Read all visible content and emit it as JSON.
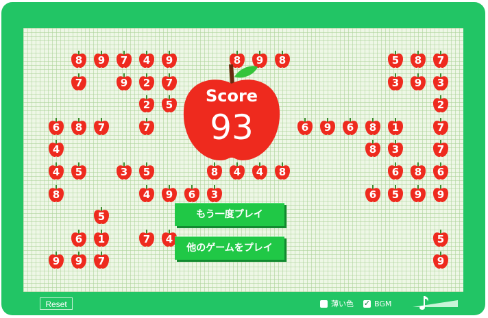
{
  "score": {
    "label": "Score",
    "value": "93"
  },
  "buttons": {
    "play_again": "もう一度プレイ",
    "other_games": "他のゲームをプレイ"
  },
  "controls": {
    "reset": "Reset",
    "pale_color": {
      "label": "薄い色",
      "checked": false
    },
    "bgm": {
      "label": "BGM",
      "checked": true
    },
    "volume_icon": "music-note-icon"
  },
  "colors": {
    "frame": "#22c565",
    "apple": "#ee2a1e",
    "leaf": "#34c43a",
    "button": "#20c846"
  },
  "apples": [
    {
      "n": "8",
      "c": 0,
      "r": 0
    },
    {
      "n": "9",
      "c": 1,
      "r": 0
    },
    {
      "n": "7",
      "c": 2,
      "r": 0
    },
    {
      "n": "4",
      "c": 3,
      "r": 0
    },
    {
      "n": "9",
      "c": 4,
      "r": 0
    },
    {
      "n": "8",
      "c": 7,
      "r": 0
    },
    {
      "n": "9",
      "c": 8,
      "r": 0
    },
    {
      "n": "8",
      "c": 9,
      "r": 0
    },
    {
      "n": "5",
      "c": 14,
      "r": 0
    },
    {
      "n": "8",
      "c": 15,
      "r": 0
    },
    {
      "n": "7",
      "c": 16,
      "r": 0
    },
    {
      "n": "7",
      "c": 0,
      "r": 1
    },
    {
      "n": "9",
      "c": 2,
      "r": 1
    },
    {
      "n": "2",
      "c": 3,
      "r": 1
    },
    {
      "n": "7",
      "c": 4,
      "r": 1
    },
    {
      "n": "3",
      "c": 14,
      "r": 1
    },
    {
      "n": "9",
      "c": 15,
      "r": 1
    },
    {
      "n": "3",
      "c": 16,
      "r": 1
    },
    {
      "n": "2",
      "c": 3,
      "r": 2
    },
    {
      "n": "5",
      "c": 4,
      "r": 2
    },
    {
      "n": "2",
      "c": 16,
      "r": 2
    },
    {
      "n": "6",
      "c": -1,
      "r": 3
    },
    {
      "n": "8",
      "c": 0,
      "r": 3
    },
    {
      "n": "7",
      "c": 1,
      "r": 3
    },
    {
      "n": "7",
      "c": 3,
      "r": 3
    },
    {
      "n": "6",
      "c": 10,
      "r": 3
    },
    {
      "n": "9",
      "c": 11,
      "r": 3
    },
    {
      "n": "6",
      "c": 12,
      "r": 3
    },
    {
      "n": "8",
      "c": 13,
      "r": 3
    },
    {
      "n": "1",
      "c": 14,
      "r": 3
    },
    {
      "n": "7",
      "c": 16,
      "r": 3
    },
    {
      "n": "4",
      "c": -1,
      "r": 4
    },
    {
      "n": "3",
      "c": 6,
      "r": 4
    },
    {
      "n": "8",
      "c": 13,
      "r": 4
    },
    {
      "n": "3",
      "c": 14,
      "r": 4
    },
    {
      "n": "7",
      "c": 16,
      "r": 4
    },
    {
      "n": "4",
      "c": -1,
      "r": 5
    },
    {
      "n": "5",
      "c": 0,
      "r": 5
    },
    {
      "n": "3",
      "c": 2,
      "r": 5
    },
    {
      "n": "5",
      "c": 3,
      "r": 5
    },
    {
      "n": "8",
      "c": 6,
      "r": 5
    },
    {
      "n": "4",
      "c": 7,
      "r": 5
    },
    {
      "n": "4",
      "c": 8,
      "r": 5
    },
    {
      "n": "8",
      "c": 9,
      "r": 5
    },
    {
      "n": "6",
      "c": 14,
      "r": 5
    },
    {
      "n": "8",
      "c": 15,
      "r": 5
    },
    {
      "n": "6",
      "c": 16,
      "r": 5
    },
    {
      "n": "8",
      "c": -1,
      "r": 6
    },
    {
      "n": "4",
      "c": 3,
      "r": 6
    },
    {
      "n": "9",
      "c": 4,
      "r": 6
    },
    {
      "n": "6",
      "c": 5,
      "r": 6
    },
    {
      "n": "3",
      "c": 6,
      "r": 6
    },
    {
      "n": "6",
      "c": 13,
      "r": 6
    },
    {
      "n": "5",
      "c": 14,
      "r": 6
    },
    {
      "n": "9",
      "c": 15,
      "r": 6
    },
    {
      "n": "9",
      "c": 16,
      "r": 6
    },
    {
      "n": "5",
      "c": 1,
      "r": 7
    },
    {
      "n": "6",
      "c": 0,
      "r": 8
    },
    {
      "n": "1",
      "c": 1,
      "r": 8
    },
    {
      "n": "7",
      "c": 3,
      "r": 8
    },
    {
      "n": "4",
      "c": 4,
      "r": 8
    },
    {
      "n": "5",
      "c": 16,
      "r": 8
    },
    {
      "n": "9",
      "c": -1,
      "r": 9
    },
    {
      "n": "9",
      "c": 0,
      "r": 9
    },
    {
      "n": "7",
      "c": 1,
      "r": 9
    },
    {
      "n": "9",
      "c": 16,
      "r": 9
    }
  ]
}
